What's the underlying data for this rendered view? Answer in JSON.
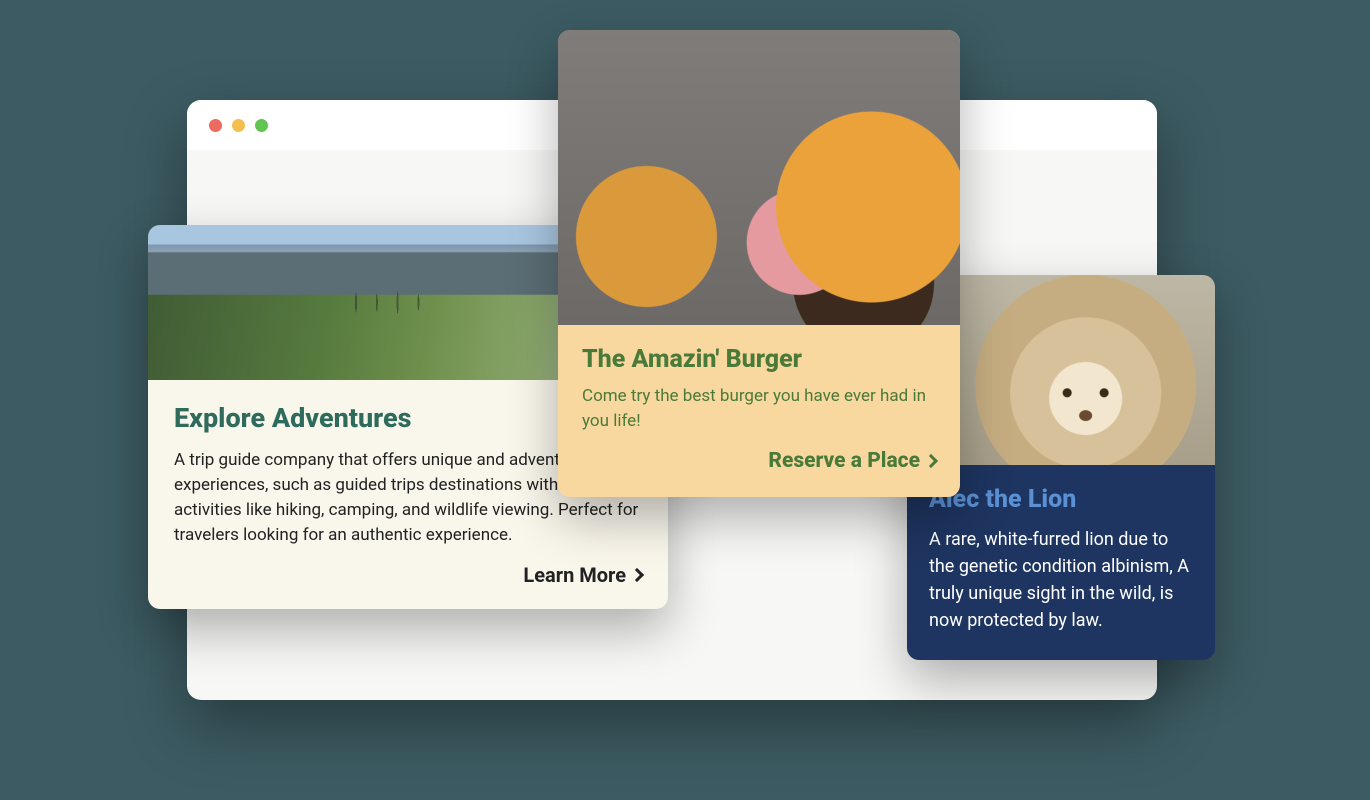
{
  "browser": {
    "traffic": [
      "close",
      "minimize",
      "maximize"
    ]
  },
  "cards": {
    "adventures": {
      "title": "Explore Adventures",
      "description": "A trip guide company that offers unique and adventure experiences, such as guided trips destinations with outdoor activities like hiking, camping, and wildlife viewing. Perfect for travelers looking for an authentic experience.",
      "cta": "Learn More",
      "image_alt": "mountain-river-landscape"
    },
    "burger": {
      "title": "The Amazin' Burger",
      "description": "Come try the best burger you have ever had in you life!",
      "cta": "Reserve a Place",
      "image_alt": "cheeseburger-photo"
    },
    "lion": {
      "title": "Alec the Lion",
      "description": "A rare, white-furred lion due to the genetic condition albinism, A truly unique sight in the wild, is now protected by law.",
      "image_alt": "white-lion-photo"
    }
  },
  "colors": {
    "page_bg": "#3c5b62",
    "card1_bg": "#f9f6eb",
    "card1_title": "#2f6b5d",
    "card2_bg": "#f8d89e",
    "card2_accent": "#4a7a3a",
    "card3_bg": "#1e3561",
    "card3_title": "#5b91d4"
  }
}
